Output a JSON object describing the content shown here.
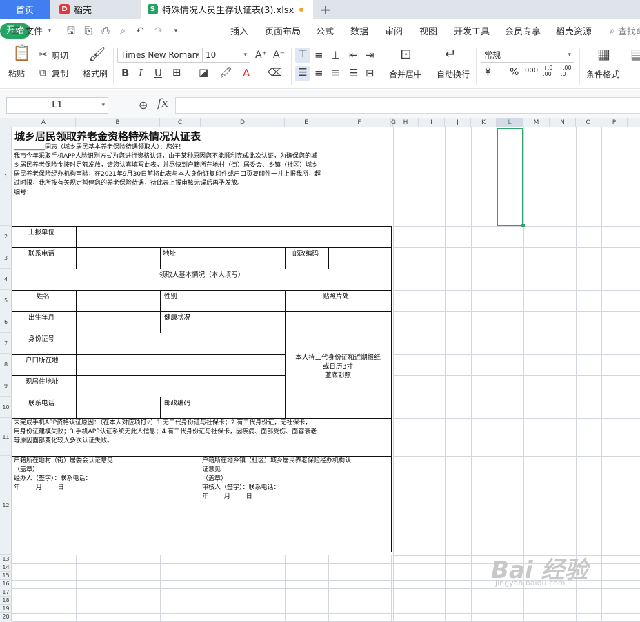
{
  "tabs": {
    "home": "首页",
    "daoke": "稻壳",
    "file": "特殊情况人员生存认证表(3).xlsx",
    "add": "+"
  },
  "menu": {
    "file": "文件",
    "items": [
      "开始",
      "插入",
      "页面布局",
      "公式",
      "数据",
      "审阅",
      "视图",
      "开发工具",
      "会员专享",
      "稻壳资源"
    ],
    "search": "查找命"
  },
  "ribbon": {
    "paste": "粘贴",
    "cut": "剪切",
    "copy": "复制",
    "format_painter": "格式刷",
    "font_name": "Times New Roman",
    "font_size": "10",
    "merge": "合并居中",
    "wrap": "自动换行",
    "number_format": "常规",
    "cond_format": "条件格式",
    "currency": "¥",
    "percent": "%",
    "thousands": "000",
    "dec_inc": "+.0\n.00",
    "dec_dec": "-.00\n.0"
  },
  "formula": {
    "cell_ref": "L1",
    "fx": "fx",
    "value": ""
  },
  "columns": [
    "A",
    "B",
    "C",
    "D",
    "E",
    "F",
    "G",
    "H",
    "I",
    "J",
    "K",
    "L",
    "M",
    "N",
    "O",
    "P"
  ],
  "rows": [
    "1",
    "2",
    "3",
    "4",
    "5",
    "6",
    "7",
    "8",
    "9",
    "10",
    "11",
    "12",
    "13",
    "14",
    "15",
    "16",
    "17",
    "18",
    "19",
    "20",
    "21"
  ],
  "form": {
    "title": "城乡居民领取养老金资格特殊情况认证表",
    "greeting": "__________同志（城乡居民基本养老保险待遇领取人）：您好！",
    "intro_lines": [
      "我市今年采取手机APP人脸识别方式为您进行资格认证，由于某种原因您不能顺利完成此次认证，为确保您的城",
      "乡居民养老保险金按时足额发放，请您认真填写此表，并尽快到户籍所在地村（街）居委会、乡镇（社区）城乡",
      "居民养老保险经办机构审验，在2021年9月30日前将此表与本人身份证复印件或户口页复印件一并上报我所，超",
      "过时限，我所按有关规定暂停您的养老保险待遇，待此表上报审核无误后再予发放。"
    ],
    "number_label": "编号：",
    "unit": "上报单位",
    "phone": "联系电话",
    "address": "地址",
    "postcode": "邮政编码",
    "basic_info": "领取人基本情况（本人填写）",
    "name": "姓名",
    "gender": "性别",
    "photo": "贴照片处",
    "birth": "出生年月",
    "health": "健康状况",
    "id": "身份证号",
    "hukou": "户口所在地",
    "current_addr": "现居住地址",
    "phone2": "联系电话",
    "postcode2": "邮政编码",
    "photo_note": [
      "本人持二代身份证和近期报纸",
      "或日历3寸",
      "蓝底彩照"
    ],
    "reason_lines": [
      "未完成手机APP资格认证原因：（在本人对应项打√）1.无二代身份证与社保卡；2.有二代身份证，无社保卡，",
      "用身份证建模失败；3.手机APP认证系统无此人信息；4.有二代身份证与社保卡，因疾病、面部受伤、面容衰老",
      "等原因面部变化较大多次认证失败。"
    ],
    "village_lines": [
      "户籍所在地村（街）居委会认证意见",
      "（盖章）",
      "经办人（签字）：联系电话：",
      "年        月        日"
    ],
    "town_lines": [
      "户籍所在地乡镇（社区）城乡居民养老保险经办机构认",
      "证意见",
      "（盖章）",
      "审核人（签字）：联系电话：",
      "年        月        日"
    ]
  },
  "watermark": {
    "text": "Bai 经验",
    "sub": "jingyan.baidu.com"
  }
}
